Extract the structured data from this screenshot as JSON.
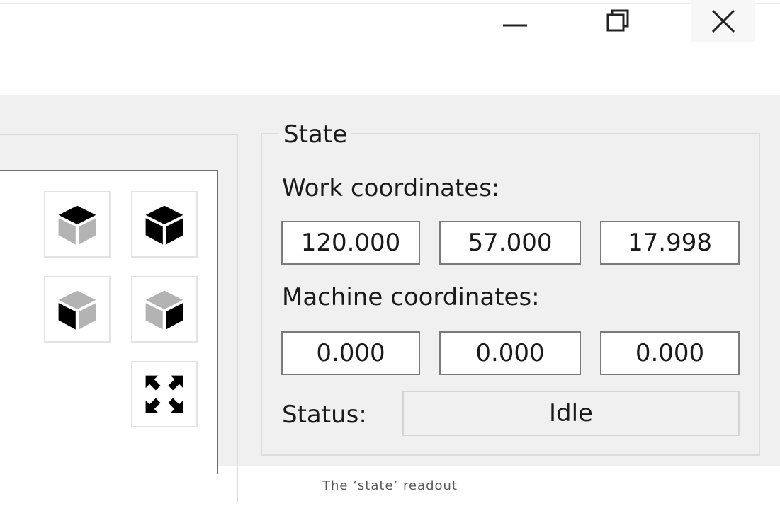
{
  "window": {
    "controls": {
      "minimize_icon": "minimize-icon",
      "restore_icon": "restore-icon",
      "close_icon": "close-icon"
    }
  },
  "view_controls": {
    "buttons": [
      {
        "name": "view-top-button",
        "icon": "cube-top-icon"
      },
      {
        "name": "view-iso-button",
        "icon": "cube-iso-icon"
      },
      {
        "name": "view-left-button",
        "icon": "cube-left-icon"
      },
      {
        "name": "view-right-button",
        "icon": "cube-right-icon"
      },
      {
        "name": "fit-view-button",
        "icon": "fit-view-icon"
      }
    ]
  },
  "state": {
    "title": "State",
    "work_label": "Work coordinates:",
    "work": {
      "x": "120.000",
      "y": "57.000",
      "z": "17.998"
    },
    "machine_label": "Machine coordinates:",
    "machine": {
      "x": "0.000",
      "y": "0.000",
      "z": "0.000"
    },
    "status_label": "Status:",
    "status_value": "Idle"
  },
  "caption": "The ‘state’ readout",
  "colors": {
    "client_bg": "#f0f0f0",
    "field_border": "#7a7a7a",
    "text": "#1a1a1a",
    "cube_dark": "#000000",
    "cube_gray": "#b3b3b3"
  }
}
